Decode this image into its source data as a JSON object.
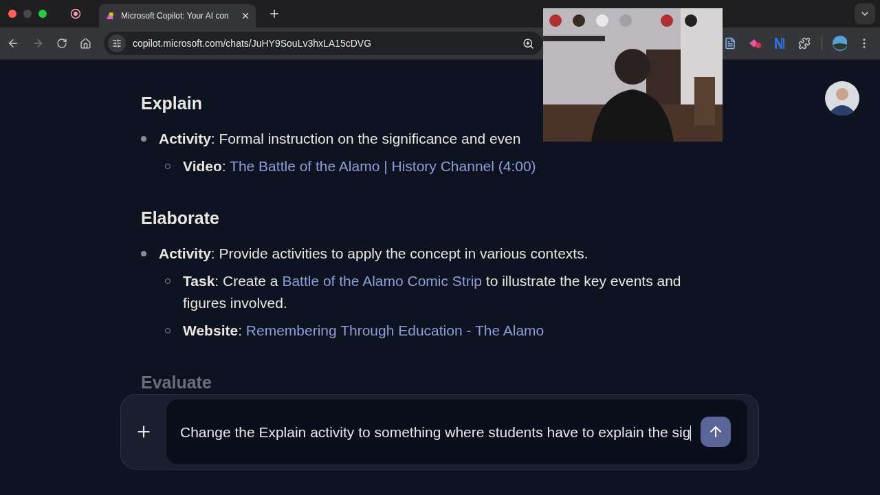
{
  "browser": {
    "tabs": [
      {
        "title": "Microsoft Copilot: Your AI con",
        "selected": true
      }
    ],
    "url": "copilot.microsoft.com/chats/JuHY9SouLv3hxLA15cDVG"
  },
  "sections": [
    {
      "heading": "Explain",
      "faded": false,
      "items": [
        {
          "parts": [
            {
              "kind": "text",
              "text": "**Activity**: Formal instruction on the significance and even"
            }
          ],
          "children": [
            {
              "parts": [
                {
                  "kind": "text",
                  "text": "**Video**: "
                },
                {
                  "kind": "link",
                  "text": "The Battle of the Alamo | History Channel (4:00)"
                }
              ]
            }
          ]
        }
      ]
    },
    {
      "heading": "Elaborate",
      "faded": false,
      "items": [
        {
          "parts": [
            {
              "kind": "text",
              "text": "**Activity**: Provide activities to apply the concept in various contexts."
            }
          ],
          "children": [
            {
              "parts": [
                {
                  "kind": "text",
                  "text": "**Task**: Create a "
                },
                {
                  "kind": "link",
                  "text": "Battle of the Alamo Comic Strip"
                },
                {
                  "kind": "text",
                  "text": " to illustrate the key events and figures involved."
                }
              ]
            },
            {
              "parts": [
                {
                  "kind": "text",
                  "text": "**Website**: "
                },
                {
                  "kind": "link",
                  "text": "Remembering Through Education - The Alamo"
                }
              ]
            }
          ]
        }
      ]
    },
    {
      "heading": "Evaluate",
      "faded": true
    }
  ],
  "composer": {
    "value": "Change the Explain activity to something where students have to explain the sig"
  }
}
